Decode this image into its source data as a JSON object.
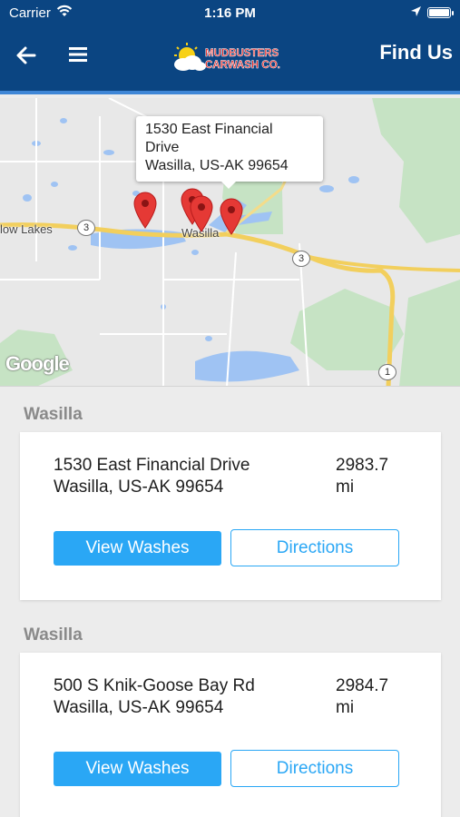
{
  "status_bar": {
    "carrier": "Carrier",
    "time": "1:16 PM"
  },
  "header": {
    "title": "Find Us",
    "logo_line1": "MUDBUSTERS",
    "logo_line2": "CARWASH CO.",
    "brand_color": "#0b4582",
    "accent_color": "#3f86d6"
  },
  "map": {
    "info_window": {
      "line1": "1530 East Financial",
      "line2": "Drive",
      "line3": "Wasilla, US-AK  99654"
    },
    "labels": {
      "town": "Wasilla",
      "west_town": "low Lakes"
    },
    "route_shields": [
      "3",
      "3",
      "1"
    ],
    "attribution": "Google",
    "pin_count": 4,
    "pin_color": "#e53935"
  },
  "locations": [
    {
      "section": "Wasilla",
      "address_line1": "1530 East Financial Drive",
      "address_line2": "Wasilla, US-AK  99654",
      "distance_value": "2983.7",
      "distance_unit": "mi",
      "view_label": "View Washes",
      "directions_label": "Directions"
    },
    {
      "section": "Wasilla",
      "address_line1": "500 S Knik-Goose Bay Rd",
      "address_line2": "Wasilla, US-AK  99654",
      "distance_value": "2984.7",
      "distance_unit": "mi",
      "view_label": "View Washes",
      "directions_label": "Directions"
    }
  ],
  "button_color": "#2aa7f5"
}
